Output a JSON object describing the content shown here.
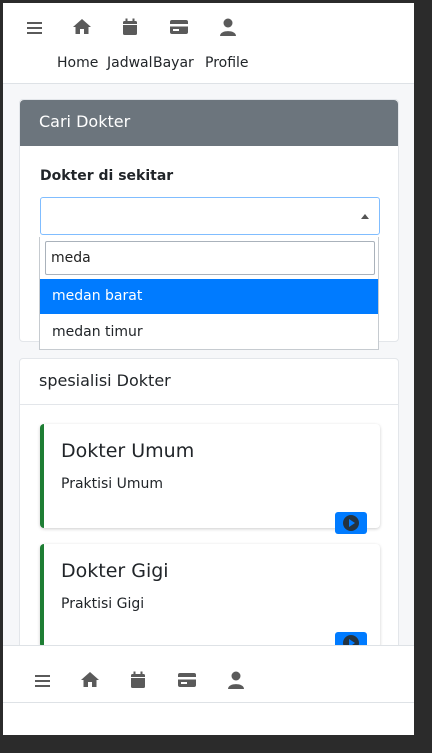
{
  "top_nav": {
    "home_label": "Home",
    "jadwal_label": "Jadwal",
    "bayar_label": "Bayar",
    "profile_label": "Profile"
  },
  "search_card": {
    "header": "Cari Dokter",
    "field_label": "Dokter di sekitar",
    "selected_value": "",
    "dropdown": {
      "search_value": "meda",
      "options": [
        "medan barat",
        "medan timur"
      ],
      "highlighted": "medan barat"
    }
  },
  "specialist_card": {
    "header": "spesialisi Dokter",
    "items": [
      {
        "title": "Dokter Umum",
        "subtitle": "Praktisi Umum"
      },
      {
        "title": "Dokter Gigi",
        "subtitle": "Praktisi Gigi"
      }
    ]
  },
  "colors": {
    "primary": "#007bff",
    "header_dark": "#6c757d",
    "spec_border": "#1e7e34"
  },
  "icons": [
    "menu-icon",
    "home-icon",
    "calendar-icon",
    "credit-card-icon",
    "user-icon",
    "arrow-circle-right-icon"
  ]
}
